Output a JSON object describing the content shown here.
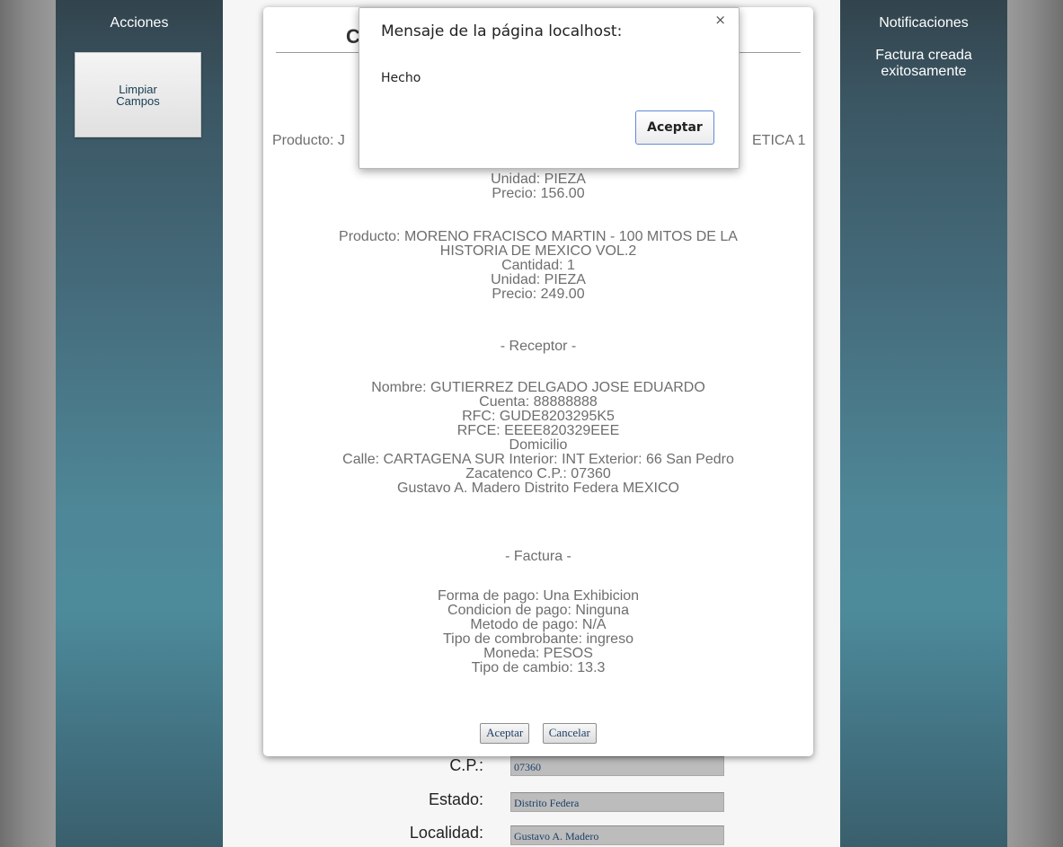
{
  "left_panel": {
    "title": "Acciones",
    "clear_button": {
      "line1": "Limpiar",
      "line2": "Campos"
    }
  },
  "right_panel": {
    "title": "Notificaciones",
    "message": "Factura creada exitosamente"
  },
  "background_form": {
    "rows": [
      {
        "label": "C.P.:",
        "value": "07360"
      },
      {
        "label": "Estado:",
        "value": "Distrito Federa"
      },
      {
        "label": "Localidad:",
        "value": "Gustavo A. Madero"
      }
    ]
  },
  "modal": {
    "title_fragment": "C",
    "product1_start": "Producto: J",
    "product1_end": "ETICA 1",
    "product1_unit": "Unidad: PIEZA",
    "product1_price": "Precio: 156.00",
    "product2_line1": "Producto: MORENO FRACISCO MARTIN - 100 MITOS DE LA",
    "product2_line2": "HISTORIA DE MEXICO VOL.2",
    "product2_qty": "Cantidad: 1",
    "product2_unit": "Unidad: PIEZA",
    "product2_price": "Precio: 249.00",
    "receptor_head": "- Receptor -",
    "receptor": {
      "name": "Nombre: GUTIERREZ DELGADO JOSE EDUARDO",
      "account": "Cuenta: 88888888",
      "rfc": "RFC: GUDE8203295K5",
      "rfce": "RFCE: EEEE820329EEE",
      "domicilio": "Domicilio",
      "address1": "Calle: CARTAGENA SUR Interior: INT Exterior: 66 San Pedro",
      "address2": "Zacatenco C.P.: 07360",
      "address3": "Gustavo A. Madero Distrito Federa MEXICO"
    },
    "factura_head": "- Factura -",
    "factura": {
      "forma": "Forma de pago: Una Exhibicion",
      "condicion": "Condicion de pago: Ninguna",
      "metodo": "Metodo de pago: N/A",
      "tipo_comp": "Tipo de combrobante: ingreso",
      "moneda": "Moneda: PESOS",
      "tipo_cambio": "Tipo de cambio: 13.3"
    },
    "accept_label": "Aceptar",
    "cancel_label": "Cancelar"
  },
  "alert": {
    "title": "Mensaje de la página localhost:",
    "message": "Hecho",
    "ok_label": "Aceptar",
    "close_symbol": "×"
  }
}
